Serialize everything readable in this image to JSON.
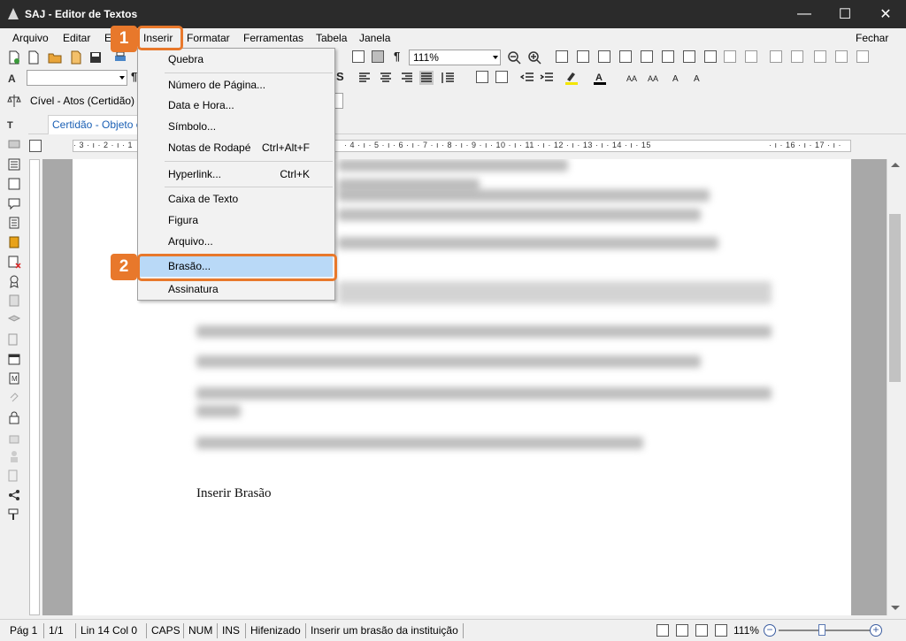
{
  "window": {
    "title": "SAJ - Editor de Textos",
    "minimize": "—",
    "maximize": "☐",
    "close": "✕"
  },
  "menubar": {
    "items": [
      "Arquivo",
      "Editar",
      "E",
      "Inserir",
      "Formatar",
      "Ferramentas",
      "Tabela",
      "Janela"
    ],
    "right": "Fechar"
  },
  "toolbar": {
    "zoom_value": "111%",
    "pilcrow": "¶",
    "bold": "S"
  },
  "context": {
    "model_combo": "Cível - Atos (Certidão)"
  },
  "tabs": {
    "active": "Certidão - Objeto e"
  },
  "ruler": {
    "left_text": "· 3 · ı · 2 · ı · 1",
    "right_text": "· 4 · ı · 5 · ı · 6 · ı · 7 · ı · 8 · ı · 9 · ı · 10 · ı · 11 · ı · 12 · ı · 13 · ı · 14 · ı · 15",
    "end_text": "· ı · 16 · ı · 17 · ı ·"
  },
  "document": {
    "visible_text": "Inserir Brasão"
  },
  "menu_inserir": {
    "items": [
      {
        "label": "Quebra",
        "shortcut": ""
      },
      {
        "label": "Número de Página...",
        "shortcut": ""
      },
      {
        "label": "Data e Hora...",
        "shortcut": ""
      },
      {
        "label": "Símbolo...",
        "shortcut": ""
      },
      {
        "label": "Notas de Rodapé",
        "shortcut": "Ctrl+Alt+F"
      },
      {
        "label": "Hyperlink...",
        "shortcut": "Ctrl+K"
      },
      {
        "label": "Caixa de Texto",
        "shortcut": ""
      },
      {
        "label": "Figura",
        "shortcut": ""
      },
      {
        "label": "Arquivo...",
        "shortcut": ""
      },
      {
        "label": "Brasão...",
        "shortcut": ""
      },
      {
        "label": "Assinatura",
        "shortcut": ""
      }
    ]
  },
  "callouts": {
    "step1": "1",
    "step2": "2"
  },
  "statusbar": {
    "page": "Pág 1",
    "pages": "1/1",
    "position": "Lin 14  Col 0",
    "caps": "CAPS",
    "num": "NUM",
    "ins": "INS",
    "hyphen": "Hifenizado",
    "hint": "Inserir um brasão da instituição",
    "zoom": "111%",
    "zoom_out": "−",
    "zoom_in": "+"
  },
  "colors": {
    "accent": "#e8782b",
    "highlight": "#b9d9f7",
    "titlebar": "#2b2b2b"
  }
}
